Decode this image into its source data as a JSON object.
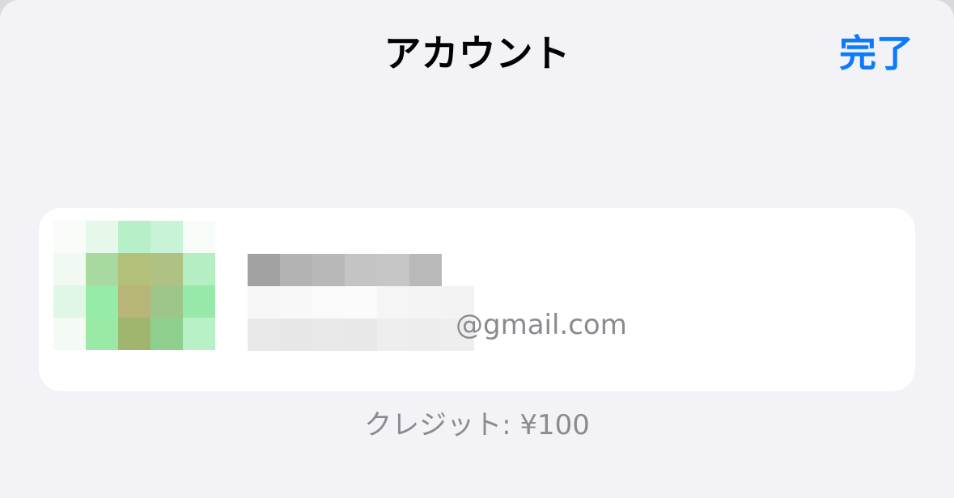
{
  "header": {
    "title": "アカウント",
    "done_label": "完了"
  },
  "account": {
    "name_text": "",
    "email_domain": "@gmail.com",
    "avatar_icon": "avatar-pixelated-icon"
  },
  "footer": {
    "credit_text": "クレジット: ¥100"
  },
  "colors": {
    "accent": "#0a7aff",
    "background": "#f2f2f7",
    "card": "#ffffff",
    "secondary_text": "#8a8a8f"
  }
}
